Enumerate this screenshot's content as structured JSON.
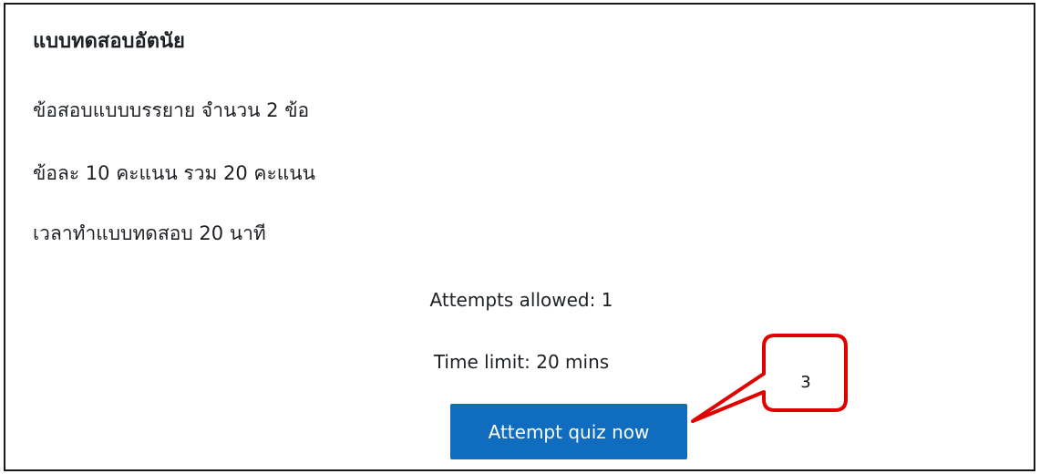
{
  "quiz": {
    "title": "แบบทดสอบอัตนัย",
    "description": [
      "ข้อสอบแบบบรรยาย จำนวน 2 ข้อ",
      "ข้อละ 10 คะแนน รวม 20 คะแนน",
      "เวลาทำแบบทดสอบ 20 นาที"
    ],
    "attempts_allowed": "Attempts allowed: 1",
    "time_limit": "Time limit: 20 mins",
    "attempt_button_label": "Attempt quiz now"
  },
  "annotation": {
    "label": "3",
    "stroke_color": "#e00000"
  },
  "colors": {
    "button": "#0f6cbf",
    "text": "#1d2125",
    "frame_border": "#1a1a1a"
  }
}
